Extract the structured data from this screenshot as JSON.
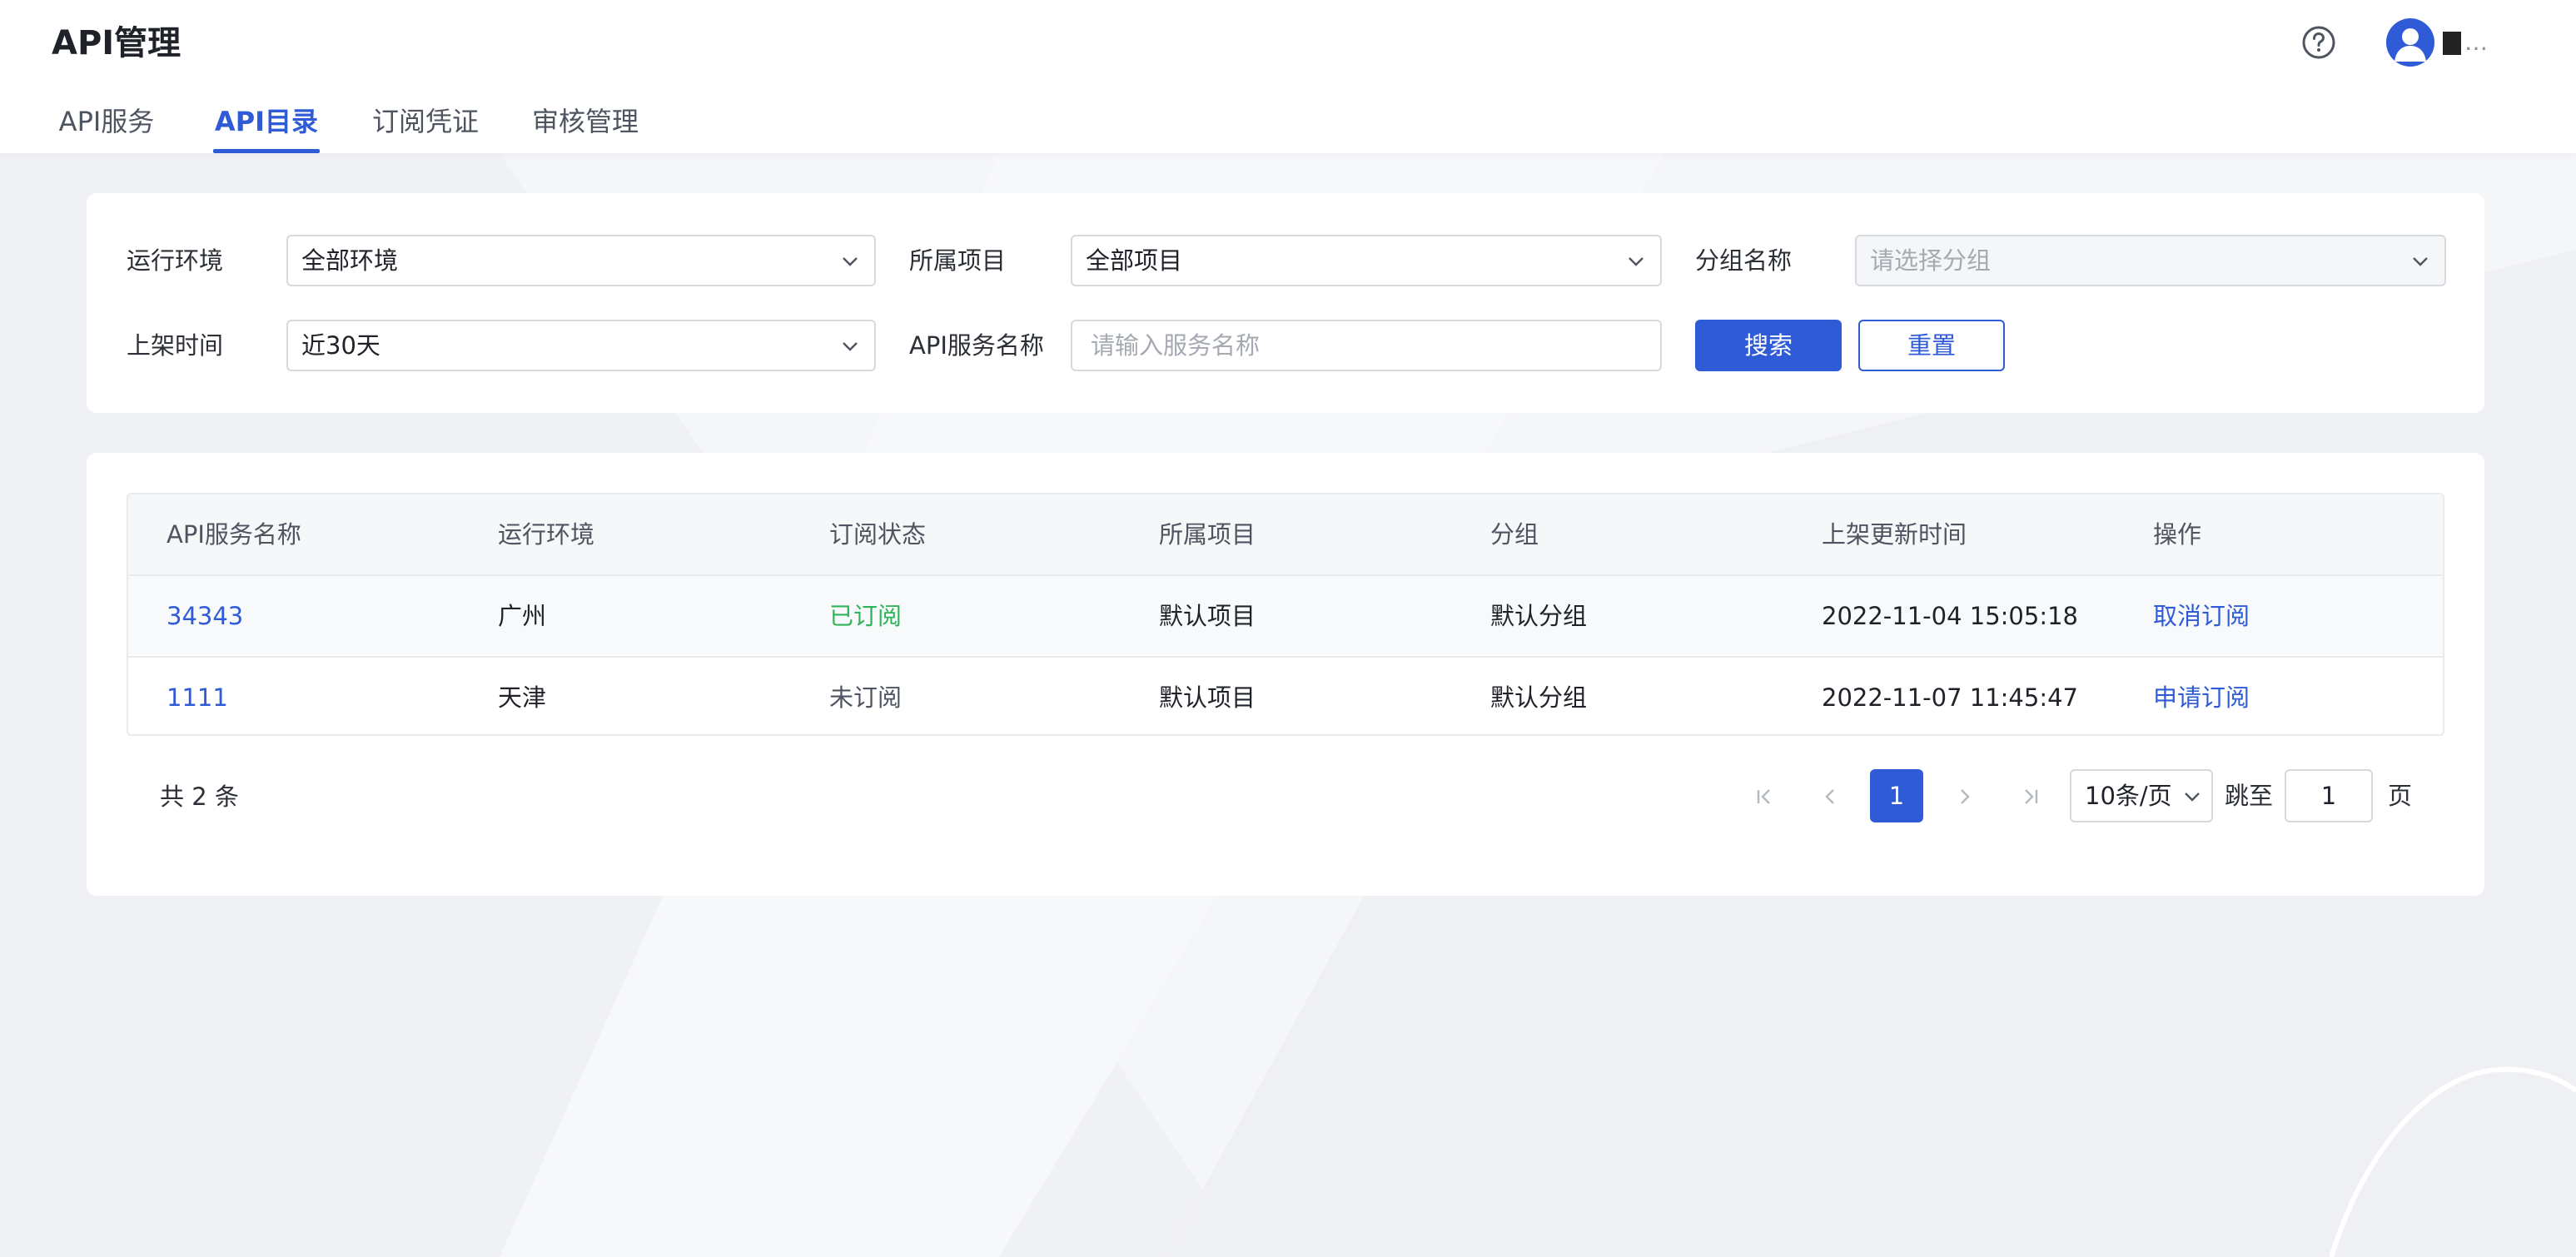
{
  "app": {
    "title": "API管理",
    "user_name": "…"
  },
  "tabs": [
    {
      "label": "API服务"
    },
    {
      "label": "API目录",
      "active": true
    },
    {
      "label": "订阅凭证"
    },
    {
      "label": "审核管理"
    }
  ],
  "filters": {
    "env": {
      "label": "运行环境",
      "value": "全部环境"
    },
    "project": {
      "label": "所属项目",
      "value": "全部项目"
    },
    "group": {
      "label": "分组名称",
      "placeholder": "请选择分组"
    },
    "time": {
      "label": "上架时间",
      "value": "近30天"
    },
    "service": {
      "label": "API服务名称",
      "placeholder": "请输入服务名称"
    },
    "search_label": "搜索",
    "reset_label": "重置"
  },
  "table": {
    "columns": [
      "API服务名称",
      "运行环境",
      "订阅状态",
      "所属项目",
      "分组",
      "上架更新时间",
      "操作"
    ],
    "rows": [
      {
        "name": "34343",
        "env": "广州",
        "status": "已订阅",
        "project": "默认项目",
        "group": "默认分组",
        "updated": "2022-11-04 15:05:18",
        "action": "取消订阅"
      },
      {
        "name": "1111",
        "env": "天津",
        "status": "未订阅",
        "project": "默认项目",
        "group": "默认分组",
        "updated": "2022-11-07 11:45:47",
        "action": "申请订阅"
      }
    ]
  },
  "pagination": {
    "total_text": "共 2 条",
    "current_page": "1",
    "page_size": "10条/页",
    "jump_label": "跳至",
    "jump_value": "1",
    "page_suffix": "页"
  },
  "colors": {
    "primary": "#2f5bd6",
    "subscribed": "#2fb45a",
    "unsubscribed": "#4e5561"
  },
  "icons": [
    "help-icon",
    "user-avatar-icon",
    "chevron-down-icon",
    "first-page-icon",
    "prev-page-icon",
    "next-page-icon",
    "last-page-icon"
  ]
}
